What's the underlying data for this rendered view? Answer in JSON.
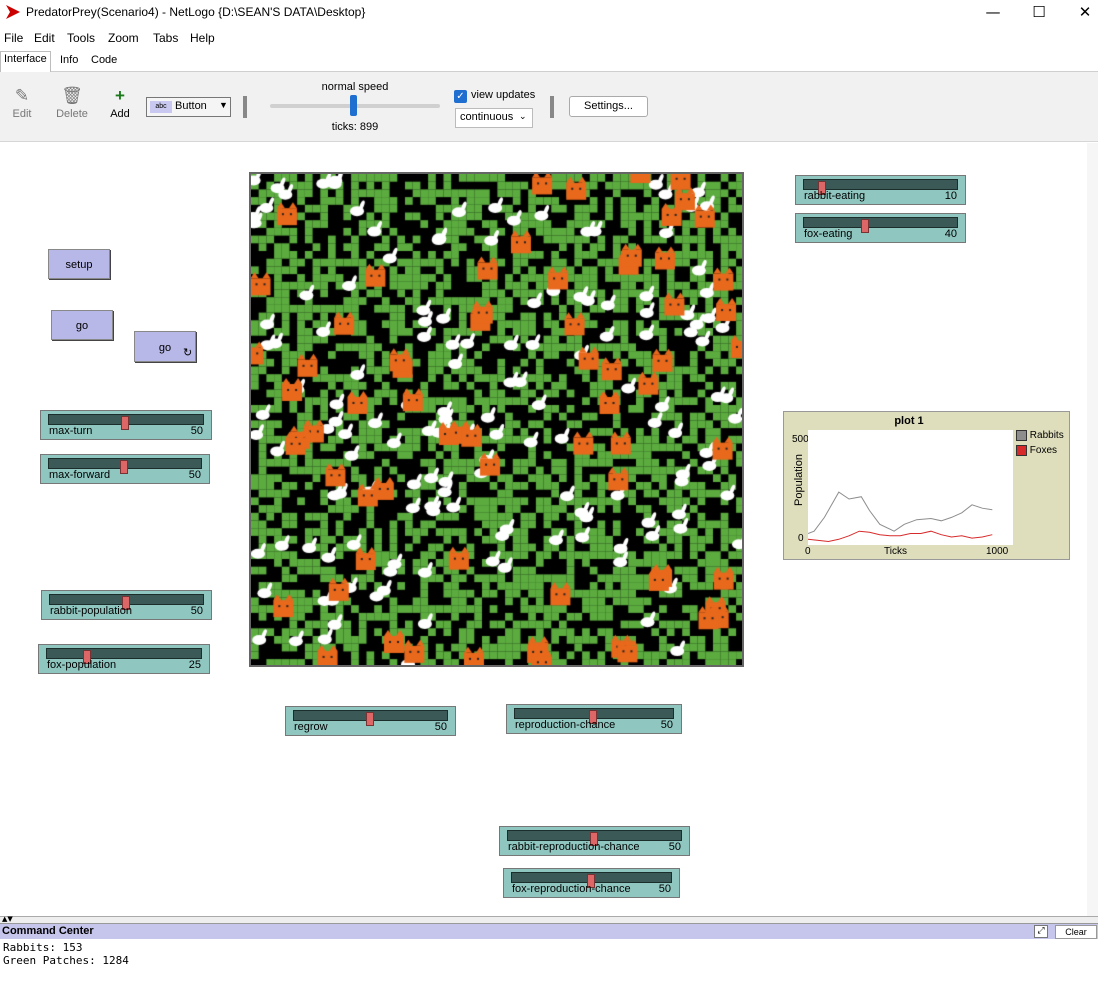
{
  "window": {
    "title": "PredatorPrey(Scenario4) - NetLogo {D:\\SEAN'S DATA\\Desktop}",
    "minimize": "—",
    "maximize": "☐",
    "close": "✕"
  },
  "menu": [
    "File",
    "Edit",
    "Tools",
    "Zoom",
    "Tabs",
    "Help"
  ],
  "tabs": [
    "Interface",
    "Info",
    "Code"
  ],
  "toolbar": {
    "edit": "Edit",
    "delete": "Delete",
    "add": "Add",
    "widget_type": "Button",
    "speed_label": "normal speed",
    "ticks": "ticks: 899",
    "view_updates": "view updates",
    "update_mode": "continuous",
    "settings": "Settings..."
  },
  "buttons": {
    "setup": "setup",
    "go_once": "go",
    "go_forever": "go"
  },
  "sliders": [
    {
      "id": "max-turn",
      "label": "max-turn",
      "value": "50",
      "fraction": 0.5
    },
    {
      "id": "max-forward",
      "label": "max-forward",
      "value": "50",
      "fraction": 0.5
    },
    {
      "id": "rabbit-population",
      "label": "rabbit-population",
      "value": "50",
      "fraction": 0.5
    },
    {
      "id": "fox-population",
      "label": "fox-population",
      "value": "25",
      "fraction": 0.25
    },
    {
      "id": "rabbit-eating",
      "label": "rabbit-eating",
      "value": "10",
      "fraction": 0.1
    },
    {
      "id": "fox-eating",
      "label": "fox-eating",
      "value": "40",
      "fraction": 0.4
    },
    {
      "id": "regrow",
      "label": "regrow",
      "value": "50",
      "fraction": 0.5
    },
    {
      "id": "reproduction-chance",
      "label": "reproduction-chance",
      "value": "50",
      "fraction": 0.5
    },
    {
      "id": "rabbit-reproduction-chance",
      "label": "rabbit-reproduction-chance",
      "value": "50",
      "fraction": 0.5
    },
    {
      "id": "fox-reproduction-chance",
      "label": "fox-reproduction-chance",
      "value": "50",
      "fraction": 0.5
    }
  ],
  "plot": {
    "title": "plot 1",
    "ylabel": "Population",
    "xlabel": "Ticks",
    "y_min": "0",
    "y_max": "500",
    "x_min": "0",
    "x_max": "1000",
    "legend": [
      {
        "name": "Rabbits",
        "color": "#8d8d8d"
      },
      {
        "name": "Foxes",
        "color": "#d72b2b"
      }
    ]
  },
  "chart_data": {
    "type": "line",
    "title": "plot 1",
    "xlabel": "Ticks",
    "ylabel": "Population",
    "xlim": [
      0,
      1000
    ],
    "ylim": [
      0,
      500
    ],
    "series": [
      {
        "name": "Rabbits",
        "x": [
          0,
          30,
          80,
          150,
          200,
          260,
          300,
          350,
          420,
          470,
          530,
          600,
          650,
          700,
          750,
          800,
          850,
          899
        ],
        "y": [
          50,
          60,
          120,
          230,
          200,
          210,
          150,
          90,
          60,
          90,
          110,
          115,
          105,
          120,
          140,
          175,
          160,
          153
        ]
      },
      {
        "name": "Foxes",
        "x": [
          0,
          50,
          100,
          150,
          200,
          250,
          300,
          350,
          400,
          450,
          500,
          550,
          600,
          650,
          700,
          750,
          800,
          850,
          899
        ],
        "y": [
          25,
          20,
          15,
          25,
          40,
          60,
          55,
          45,
          40,
          40,
          50,
          50,
          60,
          45,
          35,
          40,
          30,
          35,
          45
        ]
      }
    ]
  },
  "command_center": {
    "title": "Command Center",
    "clear": "Clear",
    "lines": [
      "Rabbits: 153",
      "Green Patches: 1284"
    ]
  },
  "colors": {
    "grass": "#5bab3f",
    "fox": "#e8681c",
    "rabbit": "#ffffff",
    "button_bg": "#b7b7e8",
    "slider_bg": "#8fc7c0"
  }
}
